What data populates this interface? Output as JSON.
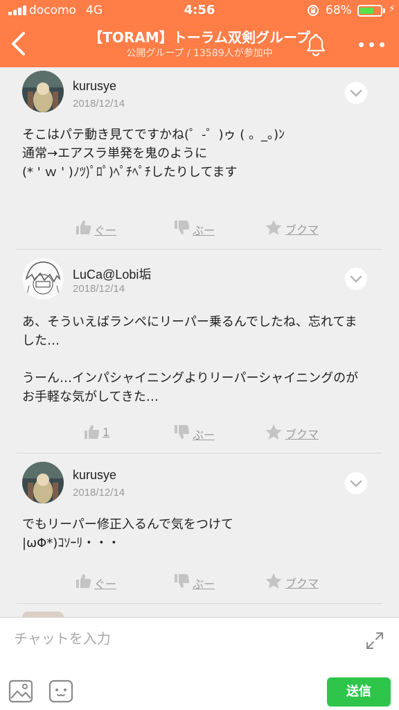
{
  "status_bar": {
    "carrier": "docomo",
    "network": "4G",
    "time": "4:56",
    "battery_percent": "68%",
    "battery_level": 0.68
  },
  "header": {
    "title": "【TORAM】トーラム双剣グループ",
    "subtitle": "公開グループ / 13589人が参加中"
  },
  "posts": [
    {
      "username": "kurusye",
      "date": "2018/12/14",
      "body": "そこはパテ動き見てですかね(゜-゜)ゥ ( 。_。)ﾝ\n通常→エアスラ単発を鬼のように\n(* ' ｗ ' )ﾉﾂ)ﾟﾛﾟ)ﾍﾟﾁﾍﾟﾁしたりしてます",
      "like_label": "ぐー",
      "dislike_label": "ぶー",
      "bookmark_label": "ブクマ"
    },
    {
      "username": "LuCa@Lobi垢",
      "date": "2018/12/14",
      "body": "あ、そういえばランペにリーパー乗るんでしたね、忘れてました…\n\nうーん…インパシャイニングよりリーパーシャイニングのがお手軽な気がしてきた…",
      "like_label": "1",
      "dislike_label": "ぶー",
      "bookmark_label": "ブクマ"
    },
    {
      "username": "kurusye",
      "date": "2018/12/14",
      "body": "でもリーパー修正入るんで気をつけて\n|ωΦ*)ｺｿｰﾘ・・・",
      "like_label": "ぐー",
      "dislike_label": "ぶー",
      "bookmark_label": "ブクマ"
    }
  ],
  "composer": {
    "placeholder": "チャットを入力",
    "send_label": "送信"
  },
  "colors": {
    "header_bg": "#ff7d47",
    "send_bg": "#2ec54a",
    "battery_fill": "#59e04a"
  }
}
